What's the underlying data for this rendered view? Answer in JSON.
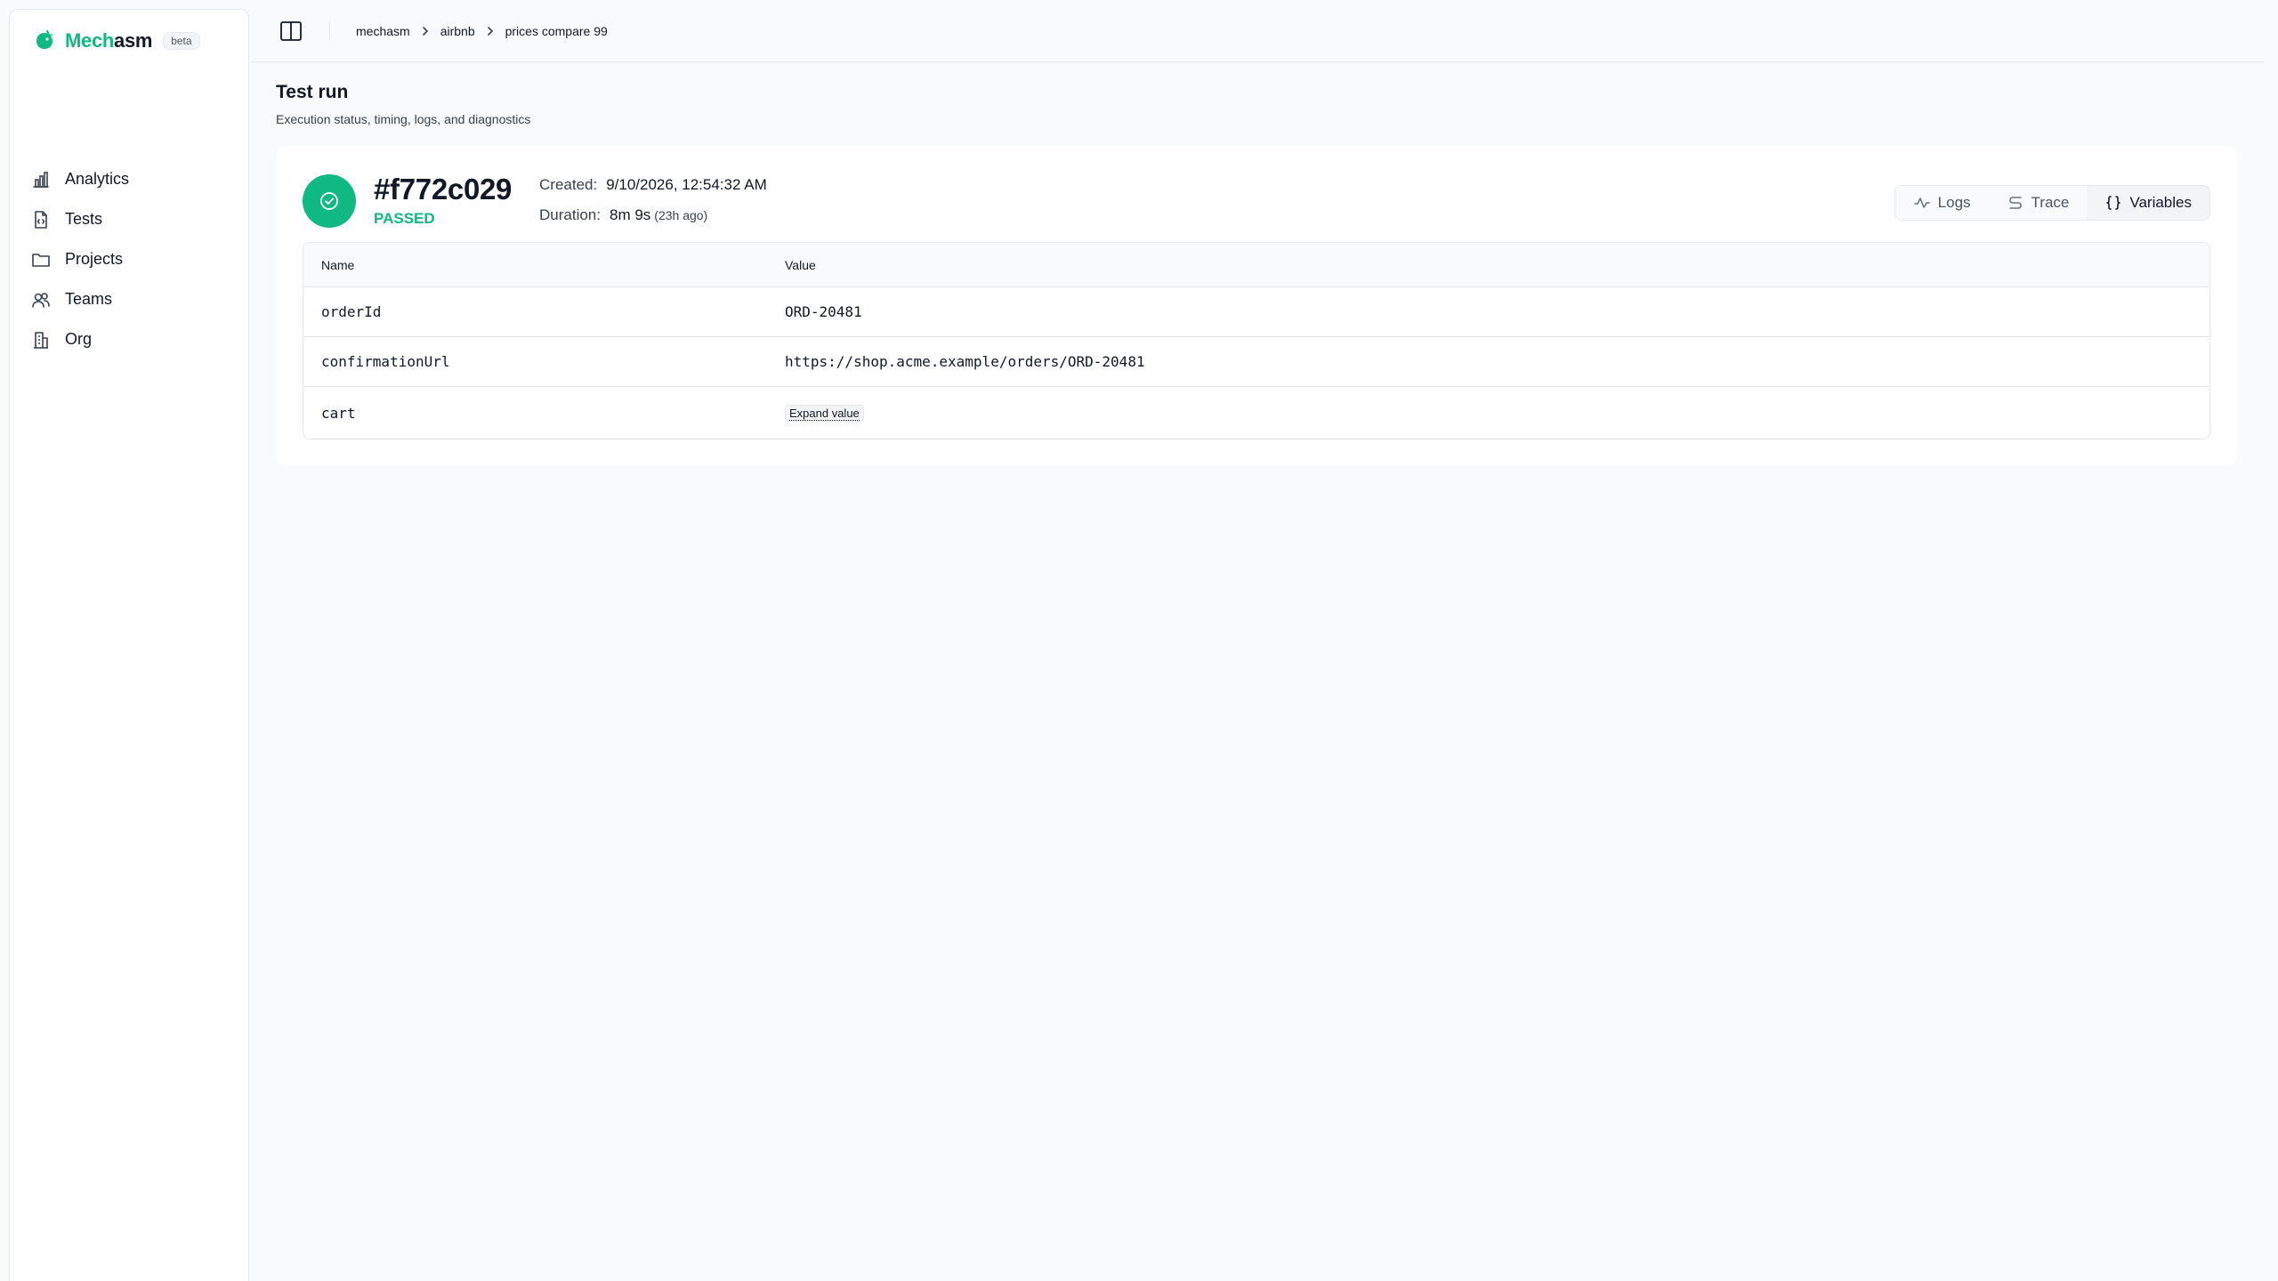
{
  "brand": {
    "name_part1": "Mech",
    "name_part2": "asm",
    "badge": "beta",
    "accent": "#10b981"
  },
  "sidebar": {
    "items": [
      {
        "label": "Analytics",
        "icon": "bar-chart-icon"
      },
      {
        "label": "Tests",
        "icon": "file-code-icon"
      },
      {
        "label": "Projects",
        "icon": "folder-icon"
      },
      {
        "label": "Teams",
        "icon": "users-icon"
      },
      {
        "label": "Org",
        "icon": "building-icon"
      }
    ]
  },
  "header": {
    "toggle_icon": "sidebar-toggle-icon",
    "breadcrumb": [
      "mechasm",
      "airbnb",
      "prices compare 99"
    ]
  },
  "page": {
    "title": "Test run",
    "subtitle": "Execution status, timing, logs, and diagnostics"
  },
  "run": {
    "id": "#f772c029",
    "status": "PASSED",
    "status_color": "#10b981",
    "created_label": "Created:",
    "created_value": "9/10/2026, 12:54:32 AM",
    "duration_label": "Duration:",
    "duration_value": "8m 9s",
    "duration_ago": "(23h ago)"
  },
  "tabs": [
    {
      "label": "Logs",
      "icon": "activity-icon",
      "active": false
    },
    {
      "label": "Trace",
      "icon": "route-icon",
      "active": false
    },
    {
      "label": "Variables",
      "icon": "braces-icon",
      "active": true
    }
  ],
  "variables": {
    "columns": [
      "Name",
      "Value"
    ],
    "rows": [
      {
        "name": "orderId",
        "value": "ORD-20481"
      },
      {
        "name": "confirmationUrl",
        "value": "https://shop.acme.example/orders/ORD-20481"
      },
      {
        "name": "cart",
        "action": "Expand value"
      }
    ]
  }
}
